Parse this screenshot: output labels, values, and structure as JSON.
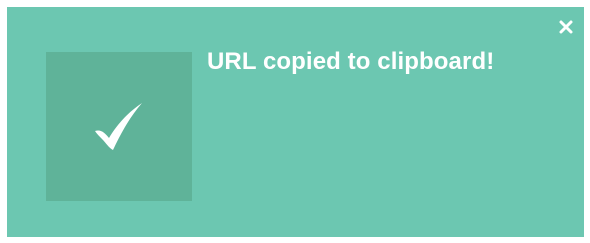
{
  "toast": {
    "message": "URL copied to clipboard!",
    "status_icon": "checkmark-icon",
    "close_icon": "close-icon",
    "colors": {
      "background": "#6cc7b1",
      "icon_box": "#5fb399",
      "text": "#ffffff"
    }
  }
}
